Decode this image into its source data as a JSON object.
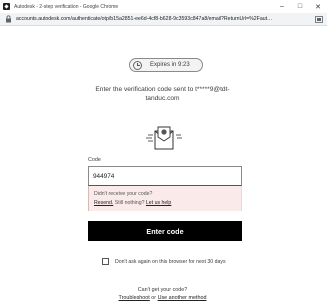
{
  "window": {
    "title": "Autodesk - 2-step verification - Google Chrome",
    "minimize_glyph": "–",
    "maximize_glyph": "□",
    "close_glyph": "✕"
  },
  "browser": {
    "url": "accounts.autodesk.com/authenticate/otp/b15a2851-ee6d-4cf8-b628-9c3593c847a8/email?ReturnUrl=%2Faut…"
  },
  "verification": {
    "expires_text": "Expires in 9:23",
    "sent_line_1": "Enter the verification code sent to t*****9@tdt-",
    "sent_line_2": "tanduc.com",
    "code_label": "Code",
    "code_value": "944974",
    "alert_line_1": "Didn't receive your code?",
    "resend_link": "Resend.",
    "still_nothing": " Still nothing? ",
    "help_link": "Let us help",
    "enter_button": "Enter code",
    "remember_label": "Don't ask again on this browser for next 30 days",
    "cant_get": "Can't get your code?",
    "troubleshoot_link": "Troubleshoot",
    "or_text": " or ",
    "other_method_link": "Use another method"
  },
  "colors": {
    "button_bg": "#000000",
    "alert_bg": "#faeaea",
    "address_bar_bg": "#f1f3f4"
  },
  "icons": {
    "title": "autodesk-logo-icon",
    "address": "lock-icon",
    "extension": "extension-icon",
    "timer": "clock-icon",
    "illustration": "envelope-icon"
  }
}
